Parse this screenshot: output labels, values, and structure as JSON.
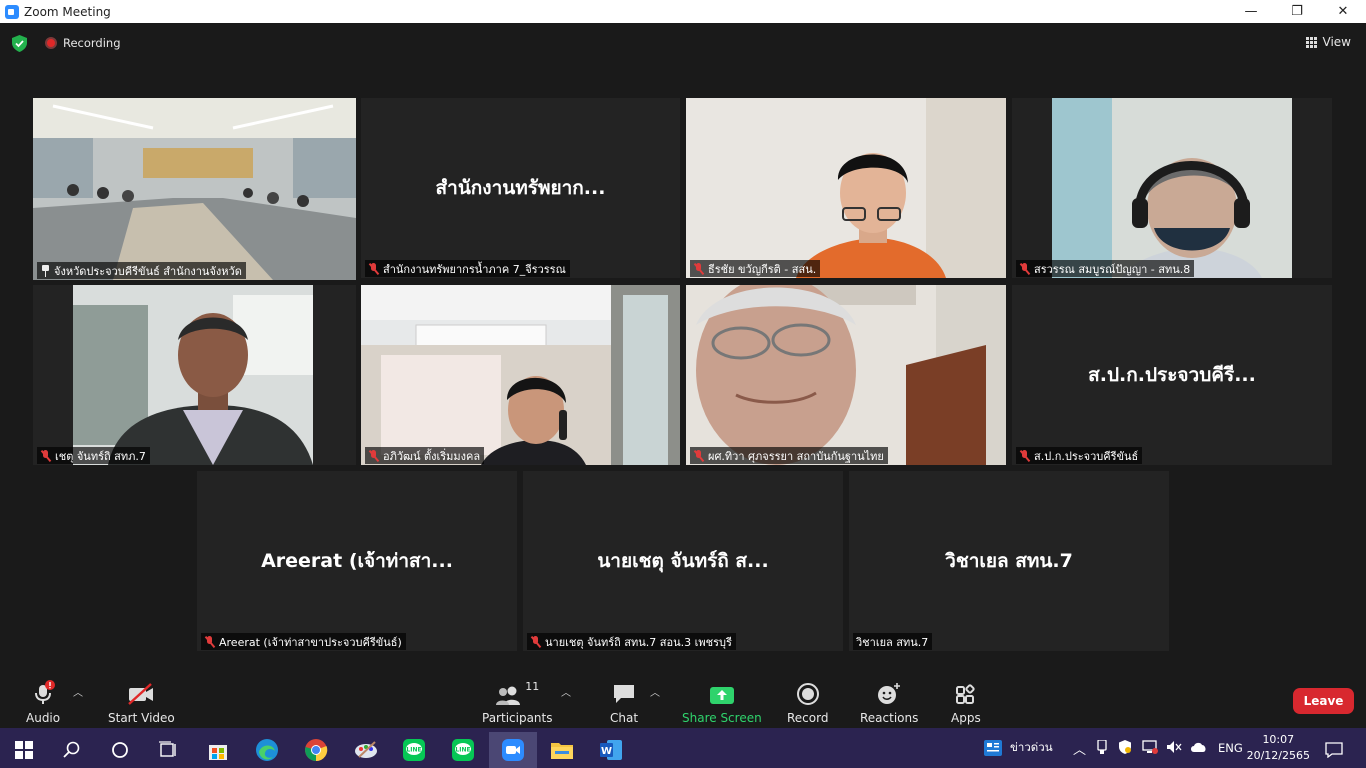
{
  "window": {
    "title": "Zoom Meeting",
    "controls": [
      "—",
      "❐",
      "✕"
    ]
  },
  "topbar": {
    "recording_label": "Recording",
    "view_label": "View"
  },
  "tiles": [
    {
      "name": "จังหวัดประจวบคีรีขันธ์ สำนักงานจังหวัด",
      "big": "",
      "video": "room",
      "active": true,
      "icon": "pin-icon"
    },
    {
      "name": "สำนักงานทรัพยากรน้ำภาค 7_จีรวรรณ",
      "big": "สำนักงานทรัพยาก...",
      "video": "",
      "active": false,
      "icon": "muted-mic-icon"
    },
    {
      "name": "ธีรชัย ขวัญกีรติ - สสน.",
      "big": "",
      "video": "person-young",
      "active": false,
      "icon": "muted-mic-icon"
    },
    {
      "name": "สรวรรณ สมบูรณ์ปัญญา - สทน.8",
      "big": "",
      "video": "person-headset",
      "active": false,
      "icon": "muted-mic-icon"
    },
    {
      "name": "เชตุ จันทร์ถิ สทภ.7",
      "big": "",
      "video": "person-office",
      "active": false,
      "icon": "muted-mic-icon"
    },
    {
      "name": "อภิวัฒน์ ตั้งเริ่มมงคล",
      "big": "",
      "video": "person-phone",
      "active": false,
      "icon": "muted-mic-icon"
    },
    {
      "name": "ผศ.ทิวา ศุภจรรยา สถาบันกันฐานไทย",
      "big": "",
      "video": "person-elder",
      "active": false,
      "icon": "muted-mic-icon"
    },
    {
      "name": "ส.ป.ก.ประจวบคีรีขันธ์",
      "big": "ส.ป.ก.ประจวบคีรี...",
      "video": "",
      "active": false,
      "icon": "muted-mic-icon"
    },
    {
      "name": "Areerat (เจ้าท่าสาขาประจวบคีรีขันธ์)",
      "big": "Areerat (เจ้าท่าสา...",
      "video": "",
      "active": false,
      "icon": "muted-mic-icon"
    },
    {
      "name": "นายเชตุ จันทร์ถิ สทน.7 สอน.3 เพชรบุรี",
      "big": "นายเชตุ จันทร์ถิ ส...",
      "video": "",
      "active": false,
      "icon": "muted-mic-icon"
    },
    {
      "name": "วิชาเยล สทน.7",
      "big": "วิชาเยล สทน.7",
      "video": "",
      "active": false,
      "icon": ""
    }
  ],
  "toolbar": {
    "audio": "Audio",
    "start_video": "Start Video",
    "participants": "Participants",
    "participants_count": "11",
    "chat": "Chat",
    "share_screen": "Share Screen",
    "record": "Record",
    "reactions": "Reactions",
    "apps": "Apps",
    "leave": "Leave"
  },
  "colors": {
    "share_green": "#2fd36c",
    "leave_red": "#d8282f",
    "active_border": "#d8e84a",
    "taskbar": "#2b2350"
  },
  "taskbar": {
    "news_label": "ข่าวด่วน",
    "lang": "ENG",
    "time": "10:07",
    "date": "20/12/2565"
  }
}
